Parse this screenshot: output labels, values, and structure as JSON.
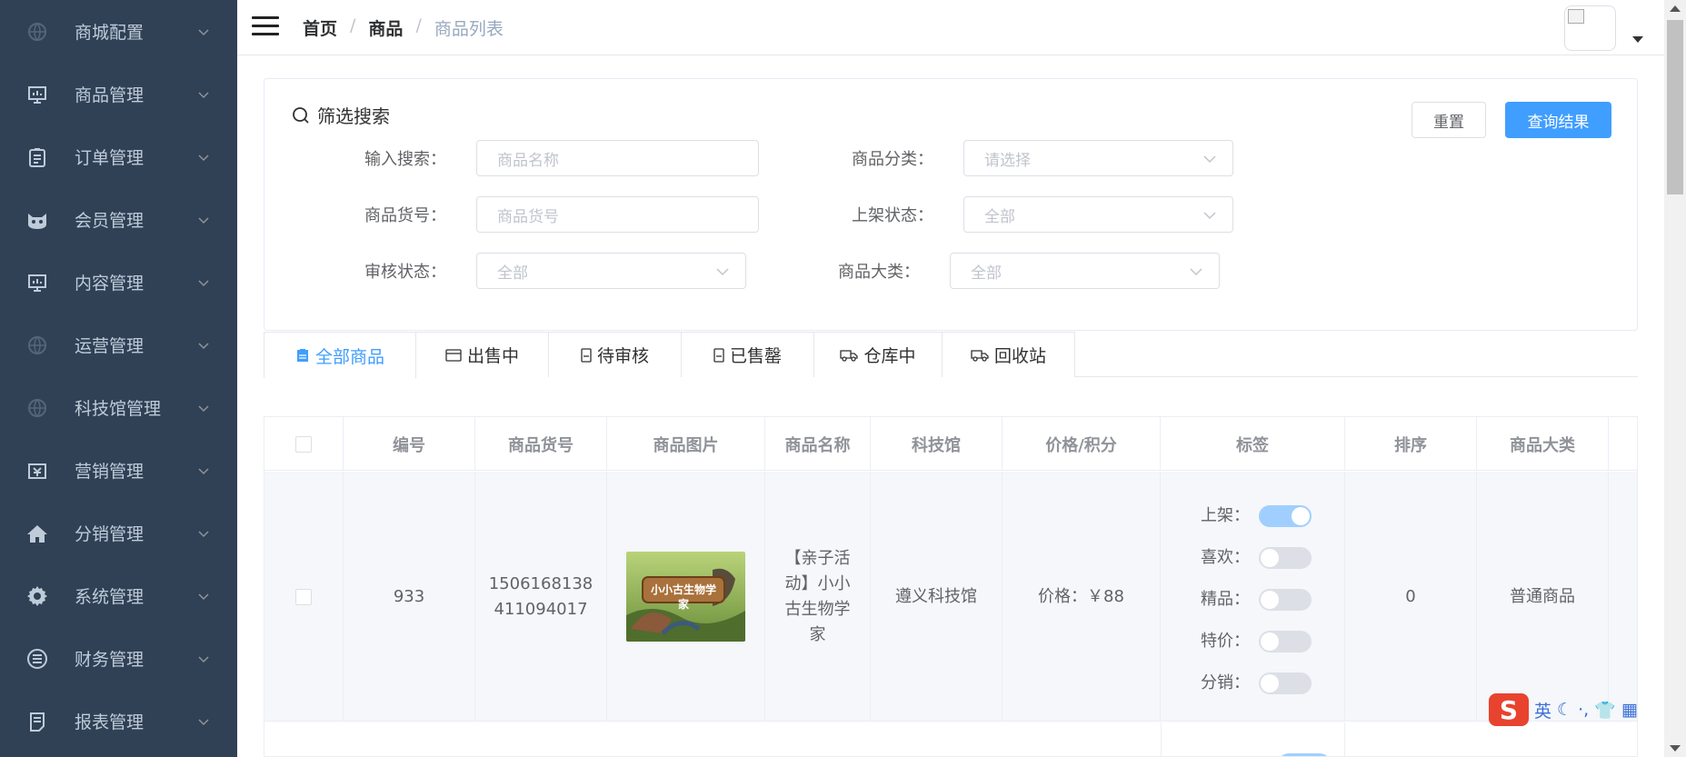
{
  "sidebar": {
    "items": [
      {
        "label": "商城配置",
        "icon": "globe-icon"
      },
      {
        "label": "商品管理",
        "icon": "monitor-icon"
      },
      {
        "label": "订单管理",
        "icon": "clipboard-icon"
      },
      {
        "label": "会员管理",
        "icon": "member-icon"
      },
      {
        "label": "内容管理",
        "icon": "monitor-icon"
      },
      {
        "label": "运营管理",
        "icon": "globe-icon"
      },
      {
        "label": "科技馆管理",
        "icon": "globe-icon"
      },
      {
        "label": "营销管理",
        "icon": "marketing-icon"
      },
      {
        "label": "分销管理",
        "icon": "home-icon"
      },
      {
        "label": "系统管理",
        "icon": "gear-icon"
      },
      {
        "label": "财务管理",
        "icon": "list-icon"
      },
      {
        "label": "报表管理",
        "icon": "report-icon"
      }
    ]
  },
  "header": {
    "breadcrumb": [
      "首页",
      "商品",
      "商品列表"
    ],
    "separator": "/"
  },
  "filter": {
    "title": "筛选搜索",
    "reset_label": "重置",
    "query_label": "查询结果",
    "fields": {
      "search_label": "输入搜索：",
      "search_placeholder": "商品名称",
      "category_label": "商品分类：",
      "category_placeholder": "请选择",
      "sku_label": "商品货号：",
      "sku_placeholder": "商品货号",
      "shelf_label": "上架状态：",
      "shelf_value": "全部",
      "audit_label": "审核状态：",
      "audit_value": "全部",
      "bigcat_label": "商品大类：",
      "bigcat_value": "全部"
    }
  },
  "tabs": [
    {
      "label": "全部商品",
      "icon": "clipboard-icon",
      "active": true
    },
    {
      "label": "出售中",
      "icon": "card-icon"
    },
    {
      "label": "待审核",
      "icon": "sim-icon"
    },
    {
      "label": "已售罄",
      "icon": "sim-icon"
    },
    {
      "label": "仓库中",
      "icon": "truck-icon"
    },
    {
      "label": "回收站",
      "icon": "truck-icon"
    }
  ],
  "table": {
    "columns": [
      "编号",
      "商品货号",
      "商品图片",
      "商品名称",
      "科技馆",
      "价格/积分",
      "标签",
      "排序",
      "商品大类"
    ],
    "rows": [
      {
        "id": "933",
        "sku_line1": "1506168138",
        "sku_line2": "411094017",
        "image_text": "小小古生物学家",
        "name_lines": [
          "【亲子活",
          "动】小小",
          "古生物学",
          "家"
        ],
        "museum": "遵义科技馆",
        "price": "价格：￥88",
        "tags": [
          {
            "label": "上架：",
            "on": true
          },
          {
            "label": "喜欢：",
            "on": false
          },
          {
            "label": "精品：",
            "on": false
          },
          {
            "label": "特价：",
            "on": false
          },
          {
            "label": "分销：",
            "on": false
          }
        ],
        "sort": "0",
        "category": "普通商品"
      }
    ]
  },
  "ime": {
    "lang": "英"
  },
  "colors": {
    "sidebar_bg": "#304156",
    "primary": "#409eff",
    "switch_on": "#a0cfff"
  }
}
